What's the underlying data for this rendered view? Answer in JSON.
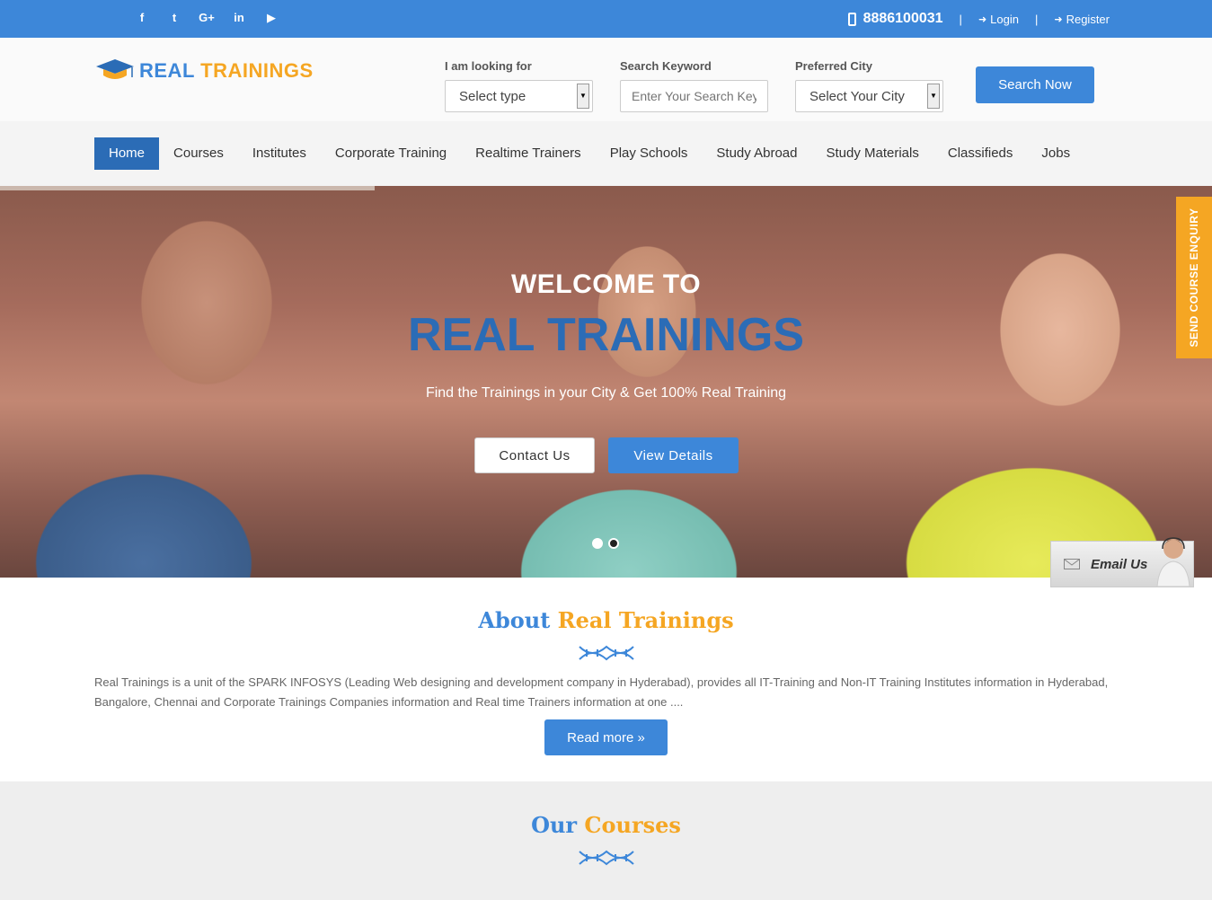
{
  "topbar": {
    "social": [
      {
        "icon": "facebook-icon",
        "glyph": "f"
      },
      {
        "icon": "twitter-icon",
        "glyph": "t"
      },
      {
        "icon": "google-plus-icon",
        "glyph": "G+"
      },
      {
        "icon": "linkedin-icon",
        "glyph": "in"
      },
      {
        "icon": "youtube-icon",
        "glyph": "▶"
      }
    ],
    "phone": "8886100031",
    "separator": "|",
    "login": "Login",
    "register": "Register"
  },
  "logo": {
    "part1": "REAL",
    "part2": "TRAININGS"
  },
  "search": {
    "type_label": "I am looking for",
    "type_value": "Select type",
    "keyword_label": "Search Keyword",
    "keyword_placeholder": "Enter Your Search Key",
    "city_label": "Preferred City",
    "city_value": "Select Your City",
    "button": "Search Now"
  },
  "nav": {
    "items": [
      "Home",
      "Courses",
      "Institutes",
      "Corporate Training",
      "Realtime Trainers",
      "Play Schools",
      "Study Abroad",
      "Study Materials",
      "Classifieds",
      "Jobs"
    ],
    "active": "Home"
  },
  "hero": {
    "welcome": "WELCOME TO",
    "title": "REAL TRAININGS",
    "description": "Find the Trainings in your City & Get 100% Real Training",
    "contact_button": "Contact Us",
    "view_button": "View Details",
    "slides": 2,
    "current_slide": 2
  },
  "enquiry_tab": "SEND COURSE ENQUIRY",
  "email_widget": "Email Us",
  "about": {
    "title_part1": "About",
    "title_part2": "Real Trainings",
    "text": "Real Trainings is a unit of the SPARK INFOSYS (Leading Web designing and development company in Hyderabad), provides all IT-Training and Non-IT Training Institutes information in Hyderabad, Bangalore, Chennai and Corporate Trainings Companies information and Real time Trainers information at one ....",
    "read_more": "Read more »"
  },
  "courses": {
    "title_part1": "Our",
    "title_part2": "Courses"
  },
  "colors": {
    "primary": "#3d87d9",
    "accent": "#f5a623",
    "nav_active": "#2b6cb6"
  }
}
